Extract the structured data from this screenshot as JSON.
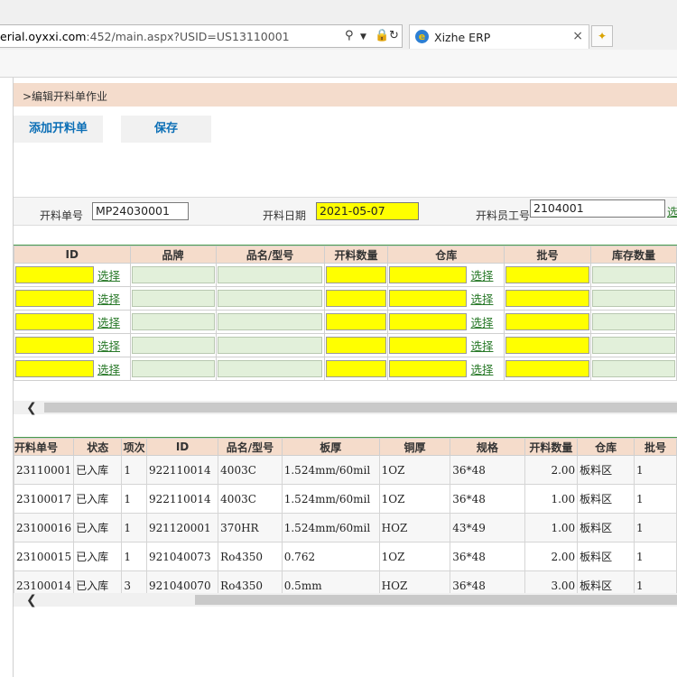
{
  "browser": {
    "url_prefix": "erial.oyxxi.com",
    "url_rest": ":452/main.aspx?USID=US13110001",
    "tab_title": "Xizhe ERP",
    "icons": [
      "search-icon",
      "dropdown-icon",
      "lock-icon",
      "refresh-icon",
      "ie-icon",
      "close-icon",
      "new-tab-icon"
    ]
  },
  "page": {
    "breadcrumb": ">编辑开料单作业",
    "add_button": "添加开料单",
    "save_button": "保存"
  },
  "form": {
    "order_no_label": "开料单号",
    "order_no_value": "MP24030001",
    "date_label": "开料日期",
    "date_value": "2021-05-07",
    "staff_label": "开料员工号",
    "staff_value": "2104001",
    "select_cut": "选"
  },
  "entry_grid": {
    "headers": [
      "ID",
      "品牌",
      "品名/型号",
      "开料数量",
      "仓库",
      "批号",
      "库存数量"
    ],
    "select_label": "选择",
    "row_count": 5
  },
  "list_grid": {
    "headers": [
      "开料单号",
      "状态",
      "项次",
      "ID",
      "品名/型号",
      "板厚",
      "铜厚",
      "规格",
      "开料数量",
      "仓库",
      "批号"
    ],
    "rows": [
      [
        "23110001",
        "已入库",
        "1",
        "922110014",
        "4003C",
        "1.524mm/60mil",
        "1OZ",
        "36*48",
        "2.00",
        "板料区",
        "1"
      ],
      [
        "23100017",
        "已入库",
        "1",
        "922110014",
        "4003C",
        "1.524mm/60mil",
        "1OZ",
        "36*48",
        "1.00",
        "板料区",
        "1"
      ],
      [
        "23100016",
        "已入库",
        "1",
        "921120001",
        "370HR",
        "1.524mm/60mil",
        "HOZ",
        "43*49",
        "1.00",
        "板料区",
        "1"
      ],
      [
        "23100015",
        "已入库",
        "1",
        "921040073",
        "Ro4350",
        "0.762",
        "1OZ",
        "36*48",
        "2.00",
        "板料区",
        "1"
      ],
      [
        "23100014",
        "已入库",
        "3",
        "921040070",
        "Ro4350",
        "0.5mm",
        "HOZ",
        "36*48",
        "3.00",
        "板料区",
        "1"
      ]
    ]
  },
  "colors": {
    "header_bg": "#f5dccb",
    "title_bg": "#f4dccc",
    "required_input": "#ffff00",
    "readonly_input": "#e2f0da",
    "link": "#2a7a2a",
    "button_text": "#0c6fb6"
  }
}
